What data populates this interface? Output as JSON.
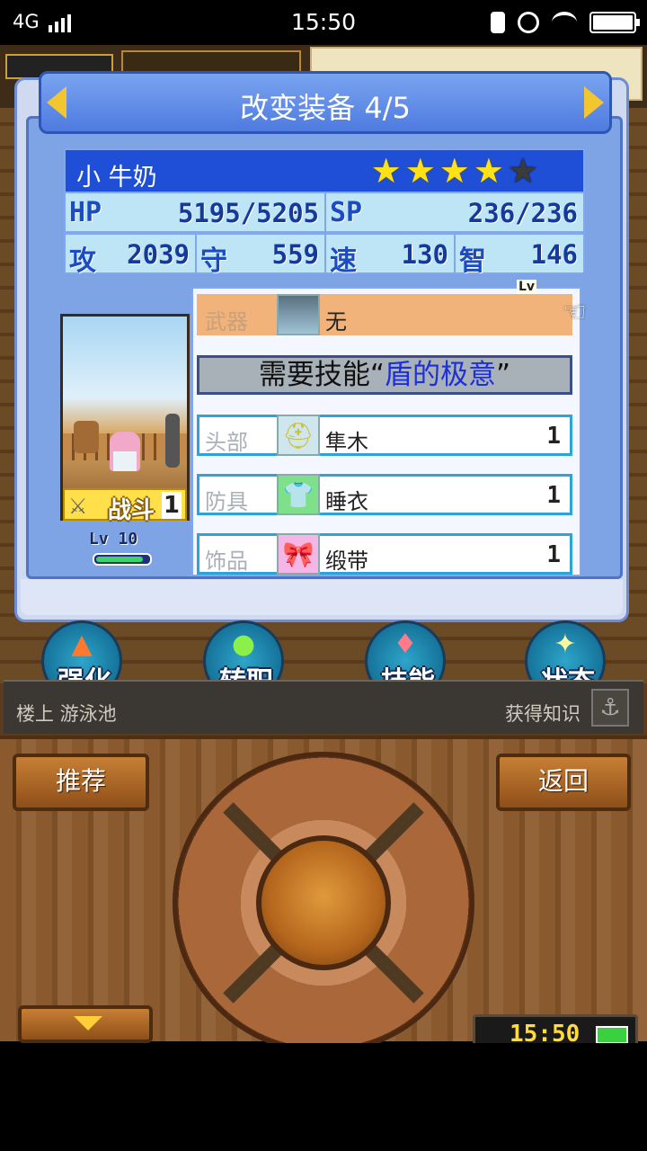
{
  "status_bar": {
    "network": "4G",
    "time": "15:50"
  },
  "dialog": {
    "title": "改变装备 4/5",
    "character": {
      "name": "小 牛奶",
      "stars_filled": 4,
      "stars_total": 5,
      "hp_label": "HP",
      "hp": "5195/5205",
      "sp_label": "SP",
      "sp": "236/236",
      "atk_label": "攻",
      "atk": "2039",
      "def_label": "守",
      "def": "559",
      "spd_label": "速",
      "spd": "130",
      "int_label": "智",
      "int": "146",
      "badge_text": "战斗",
      "badge_num": "1",
      "level_label": "Lv 10",
      "exp_fraction": 0.9
    },
    "equipment": {
      "weapon": {
        "category": "武器",
        "name": "无"
      },
      "lv_tag": "Lv",
      "need_prefix": "需要技能“",
      "need_skill": "盾的极意",
      "need_suffix": "”",
      "head": {
        "category": "头部",
        "name": "隼木",
        "qty": "1"
      },
      "armor": {
        "category": "防具",
        "name": "睡衣",
        "qty": "1"
      },
      "accessory": {
        "category": "饰品",
        "name": "缎带",
        "qty": "1"
      }
    }
  },
  "actions": [
    {
      "label": "强化",
      "icon": "up-arrow-icon"
    },
    {
      "label": "转职",
      "icon": "leaf-icon"
    },
    {
      "label": "技能",
      "icon": "flame-icon"
    },
    {
      "label": "状态",
      "icon": "sparkle-icon"
    }
  ],
  "location": {
    "left": "楼上 游泳池",
    "right": "获得知识"
  },
  "controller": {
    "recommend_label": "推荐",
    "back_label": "返回",
    "clock": "15:50"
  }
}
